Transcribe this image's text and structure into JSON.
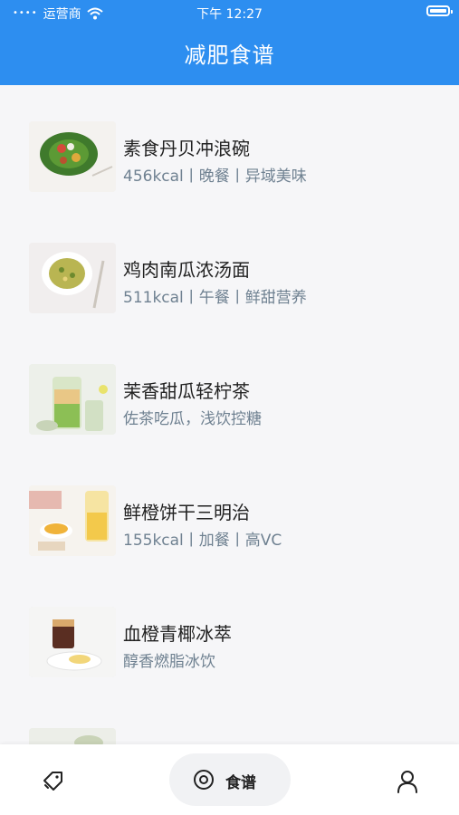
{
  "status_bar": {
    "carrier": "运营商",
    "time": "下午 12:27"
  },
  "header": {
    "title": "减肥食谱"
  },
  "recipes": [
    {
      "name": "素食丹贝冲浪碗",
      "meta": "456kcal丨晚餐丨异域美味"
    },
    {
      "name": "鸡肉南瓜浓汤面",
      "meta": "511kcal丨午餐丨鲜甜营养"
    },
    {
      "name": "茉香甜瓜轻柠茶",
      "meta": "佐茶吃瓜，浅饮控糖"
    },
    {
      "name": "鲜橙饼干三明治",
      "meta": "155kcal丨加餐丨高VC"
    },
    {
      "name": "血橙青椰冰萃",
      "meta": "醇香燃脂冰饮"
    }
  ],
  "tabbar": {
    "active_label": "食谱"
  },
  "colors": {
    "primary": "#2d8ef0",
    "meta_text": "#6f8191"
  }
}
